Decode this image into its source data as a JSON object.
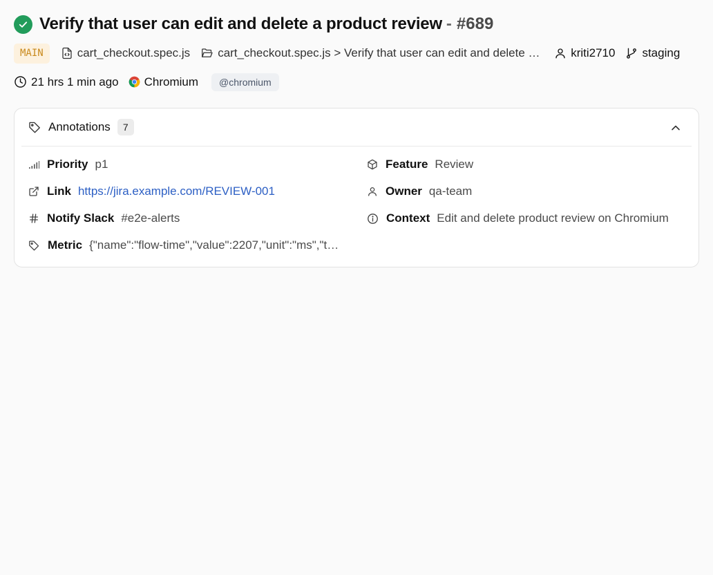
{
  "test": {
    "title": "Verify that user can edit and delete a product review",
    "separator": "-",
    "run_id": "#689",
    "status": "passed"
  },
  "meta": {
    "branch_badge": "MAIN",
    "spec_file": "cart_checkout.spec.js",
    "test_path": "cart_checkout.spec.js > Verify that user can edit and delete a product review",
    "user": "kriti2710",
    "environment": "staging",
    "time_ago": "21 hrs 1 min ago",
    "browser": "Chromium",
    "tag": "@chromium"
  },
  "annotations": {
    "title": "Annotations",
    "count": "7",
    "items": [
      {
        "key": "Priority",
        "value": "p1",
        "icon": "signal-bars-icon"
      },
      {
        "key": "Feature",
        "value": "Review",
        "icon": "cube-icon"
      },
      {
        "key": "Link",
        "value": "https://jira.example.com/REVIEW-001",
        "icon": "external-link-icon"
      },
      {
        "key": "Owner",
        "value": "qa-team",
        "icon": "user-icon"
      },
      {
        "key": "Notify Slack",
        "value": "#e2e-alerts",
        "icon": "hash-icon"
      },
      {
        "key": "Context",
        "value": "Edit and delete product review on Chromium",
        "icon": "info-icon"
      },
      {
        "key": "Metric",
        "value": "{\"name\":\"flow-time\",\"value\":2207,\"unit\":\"ms\",\"t…",
        "icon": "tag-icon"
      }
    ]
  },
  "colors": {
    "success": "#229c5b",
    "branch_badge_bg": "#fdf1de",
    "branch_badge_text": "#c98a1e",
    "link": "#2c5fc4"
  }
}
